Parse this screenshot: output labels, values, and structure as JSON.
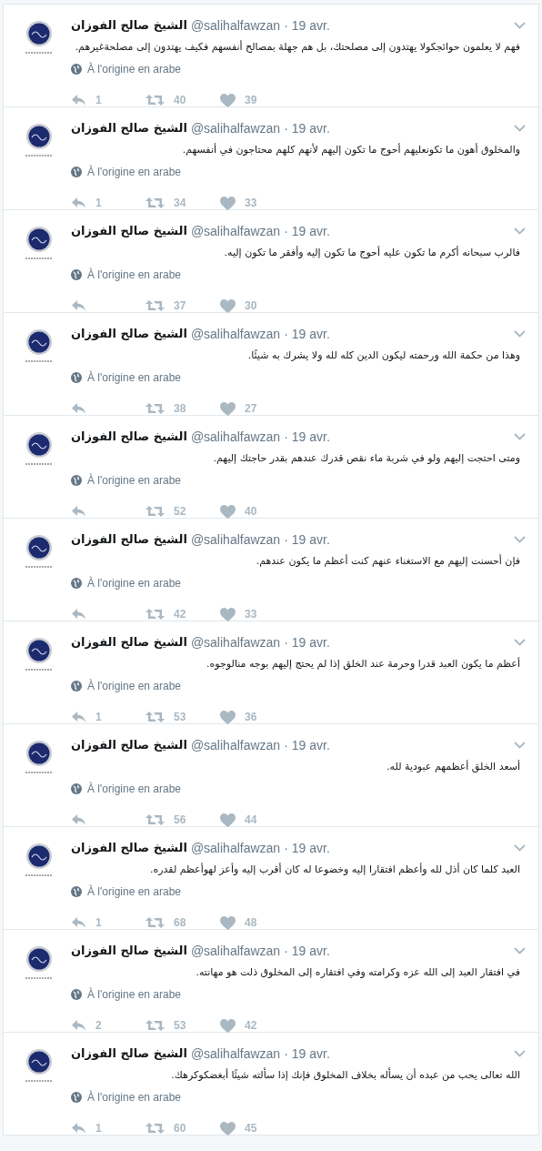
{
  "tweets": [
    {
      "name": "الشيخ صالح الفوزان",
      "handle": "@salihalfawzan",
      "separator": "·",
      "date": "19 avr.",
      "text": "فهم لا يعلمون حوائجكولا يهتدون إلى مصلحتك، بل هم جهلة بمصالح أنفسهم فكيف يهتدون إلى مصلحةغيرهم.",
      "translation": "À l'origine en arabe",
      "replies": "1",
      "retweets": "40",
      "likes": "39"
    },
    {
      "name": "الشيخ صالح الفوزان",
      "handle": "@salihalfawzan",
      "separator": "·",
      "date": "19 avr.",
      "text": "والمخلوق أهون ما تكونعليهم أحوج ما تكون إليهم لأنهم كلهم محتاجون في أنفسهم.",
      "translation": "À l'origine en arabe",
      "replies": "1",
      "retweets": "34",
      "likes": "33"
    },
    {
      "name": "الشيخ صالح الفوزان",
      "handle": "@salihalfawzan",
      "separator": "·",
      "date": "19 avr.",
      "text": "فالرب سبحانه أكرم ما تكون عليه أحوج ما تكون إليه وأفقر ما تكون إليه.",
      "translation": "À l'origine en arabe",
      "retweets": "37",
      "likes": "30"
    },
    {
      "name": "الشيخ صالح الفوزان",
      "handle": "@salihalfawzan",
      "separator": "·",
      "date": "19 avr.",
      "text": "وهذا من حكمة الله ورحمته ليكون الدين كله لله ولا يشرك به شيئًا.",
      "translation": "À l'origine en arabe",
      "retweets": "38",
      "likes": "27"
    },
    {
      "name": "الشيخ صالح الفوزان",
      "handle": "@salihalfawzan",
      "separator": "·",
      "date": "19 avr.",
      "text": "ومتى احتجت إليهم ولو في شربة ماء نقص قدرك عندهم بقدر حاجتك إليهم.",
      "translation": "À l'origine en arabe",
      "retweets": "52",
      "likes": "40"
    },
    {
      "name": "الشيخ صالح الفوزان",
      "handle": "@salihalfawzan",
      "separator": "·",
      "date": "19 avr.",
      "text": "فإن أحسنت إليهم مع الاستغناء عنهم كنت أعظم ما يكون عندهم.",
      "translation": "À l'origine en arabe",
      "retweets": "42",
      "likes": "33"
    },
    {
      "name": "الشيخ صالح الفوزان",
      "handle": "@salihalfawzan",
      "separator": "·",
      "date": "19 avr.",
      "text": "أعظم ما يكون العبد قدرا وحرمة عند الخلق إذا لم يحتج إليهم بوجه منالوجوه.",
      "translation": "À l'origine en arabe",
      "replies": "1",
      "retweets": "53",
      "likes": "36"
    },
    {
      "name": "الشيخ صالح الفوزان",
      "handle": "@salihalfawzan",
      "separator": "·",
      "date": "19 avr.",
      "text": "أسعد الخلق أعظمهم عبودية لله.",
      "translation": "À l'origine en arabe",
      "retweets": "56",
      "likes": "44"
    },
    {
      "name": "الشيخ صالح الفوزان",
      "handle": "@salihalfawzan",
      "separator": "·",
      "date": "19 avr.",
      "text": "العبد كلما كان أذل لله وأعظم افتقارا إليه وخضوعا له كان أقرب إليه وأعز لهوأعظم لقدره.",
      "translation": "À l'origine en arabe",
      "replies": "1",
      "retweets": "68",
      "likes": "48"
    },
    {
      "name": "الشيخ صالح الفوزان",
      "handle": "@salihalfawzan",
      "separator": "·",
      "date": "19 avr.",
      "text": "في افتقار العبد إلى الله عزه وكرامته وفي افتقاره إلى المخلوق ذلت هو مهانته.",
      "translation": "À l'origine en arabe",
      "replies": "2",
      "retweets": "53",
      "likes": "42"
    },
    {
      "name": "الشيخ صالح الفوزان",
      "handle": "@salihalfawzan",
      "separator": "·",
      "date": "19 avr.",
      "text": "الله تعالى يحب من عبده أن يسأله بخلاف المخلوق فإنك إذا سألته شيئًا أبغضكوكرهك.",
      "translation": "À l'origine en arabe",
      "replies": "1",
      "retweets": "60",
      "likes": "45"
    }
  ]
}
